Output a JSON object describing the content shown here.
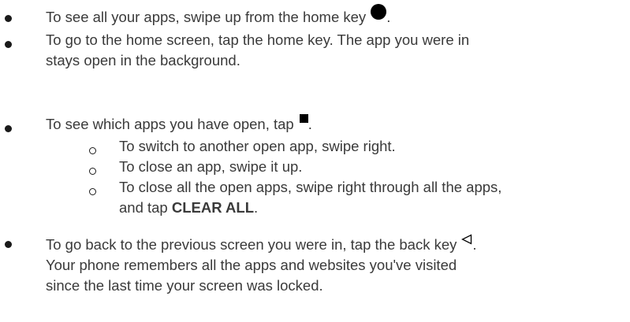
{
  "bullets": [
    {
      "text_before": "To see all your apps, swipe up from the home key",
      "icon": "home-key-circle-icon",
      "text_after": "."
    },
    {
      "line1": "To go to the home screen, tap the home key. The app you were in",
      "line2": "stays open in the background."
    },
    {
      "text_before": "To see which apps you have open, tap",
      "icon": "recent-apps-square-icon",
      "text_after": ".",
      "sub_items": [
        {
          "text": "To switch to another open app, swipe right."
        },
        {
          "text": "To close an app, swipe it up."
        },
        {
          "line1": "To close all the open apps, swipe right through all the apps,",
          "line2_before": "and tap ",
          "line2_bold": "CLEAR ALL",
          "line2_after": "."
        }
      ]
    },
    {
      "line1_before": "To go back to the previous screen you were in, tap the back key",
      "icon": "back-key-triangle-icon",
      "line1_after": ".",
      "line2": "Your phone remembers all the apps and websites you've visited",
      "line3": "since the last time your screen was locked."
    }
  ]
}
